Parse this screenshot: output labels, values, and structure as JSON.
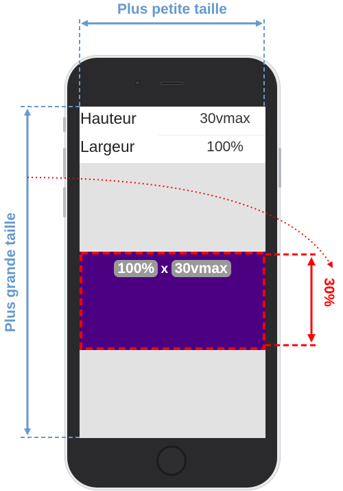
{
  "annotations": {
    "smallest_size": "Plus petite taille",
    "largest_size": "Plus grande taille",
    "percent_label": "30%"
  },
  "properties": [
    {
      "label": "Hauteur",
      "value": "30vmax"
    },
    {
      "label": "Largeur",
      "value": "100%"
    }
  ],
  "box": {
    "width_label": "100%",
    "times": "x",
    "height_label": "30vmax",
    "color": "#4b0082"
  },
  "colors": {
    "annotation_blue": "#6699cc",
    "annotation_red": "#ff0000"
  },
  "icons": {
    "home": "home-button-icon",
    "camera": "camera-icon",
    "speaker": "speaker-icon"
  }
}
